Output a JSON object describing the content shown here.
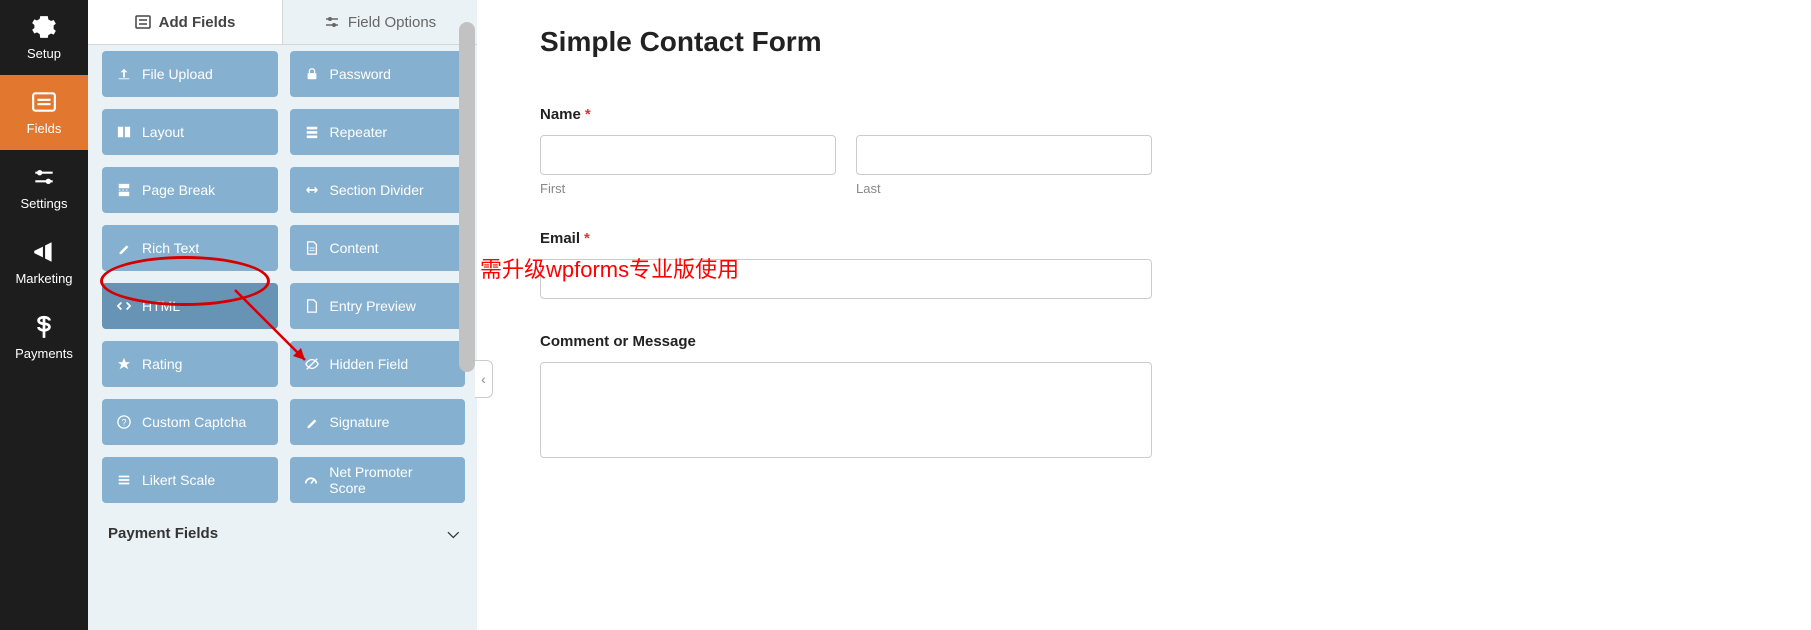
{
  "sidebar": {
    "items": [
      {
        "label": "Setup",
        "icon": "gear"
      },
      {
        "label": "Fields",
        "icon": "form"
      },
      {
        "label": "Settings",
        "icon": "sliders"
      },
      {
        "label": "Marketing",
        "icon": "megaphone"
      },
      {
        "label": "Payments",
        "icon": "dollar"
      }
    ]
  },
  "panel": {
    "tabs": [
      {
        "label": "Add Fields"
      },
      {
        "label": "Field Options"
      }
    ],
    "fields": [
      {
        "label": "File Upload",
        "icon": "upload"
      },
      {
        "label": "Password",
        "icon": "lock"
      },
      {
        "label": "Layout",
        "icon": "columns"
      },
      {
        "label": "Repeater",
        "icon": "list"
      },
      {
        "label": "Page Break",
        "icon": "pagebreak"
      },
      {
        "label": "Section Divider",
        "icon": "divider"
      },
      {
        "label": "Rich Text",
        "icon": "richtext"
      },
      {
        "label": "Content",
        "icon": "file"
      },
      {
        "label": "HTML",
        "icon": "code"
      },
      {
        "label": "Entry Preview",
        "icon": "eye"
      },
      {
        "label": "Rating",
        "icon": "star"
      },
      {
        "label": "Hidden Field",
        "icon": "eye-off"
      },
      {
        "label": "Custom Captcha",
        "icon": "question"
      },
      {
        "label": "Signature",
        "icon": "pen"
      },
      {
        "label": "Likert Scale",
        "icon": "chart"
      },
      {
        "label": "Net Promoter Score",
        "icon": "gauge"
      }
    ],
    "accordion_label": "Payment Fields"
  },
  "form": {
    "title": "Simple Contact Form",
    "name_label": "Name",
    "first_label": "First",
    "last_label": "Last",
    "email_label": "Email",
    "comment_label": "Comment or Message"
  },
  "annotation": {
    "text": "需升级wpforms专业版使用"
  }
}
